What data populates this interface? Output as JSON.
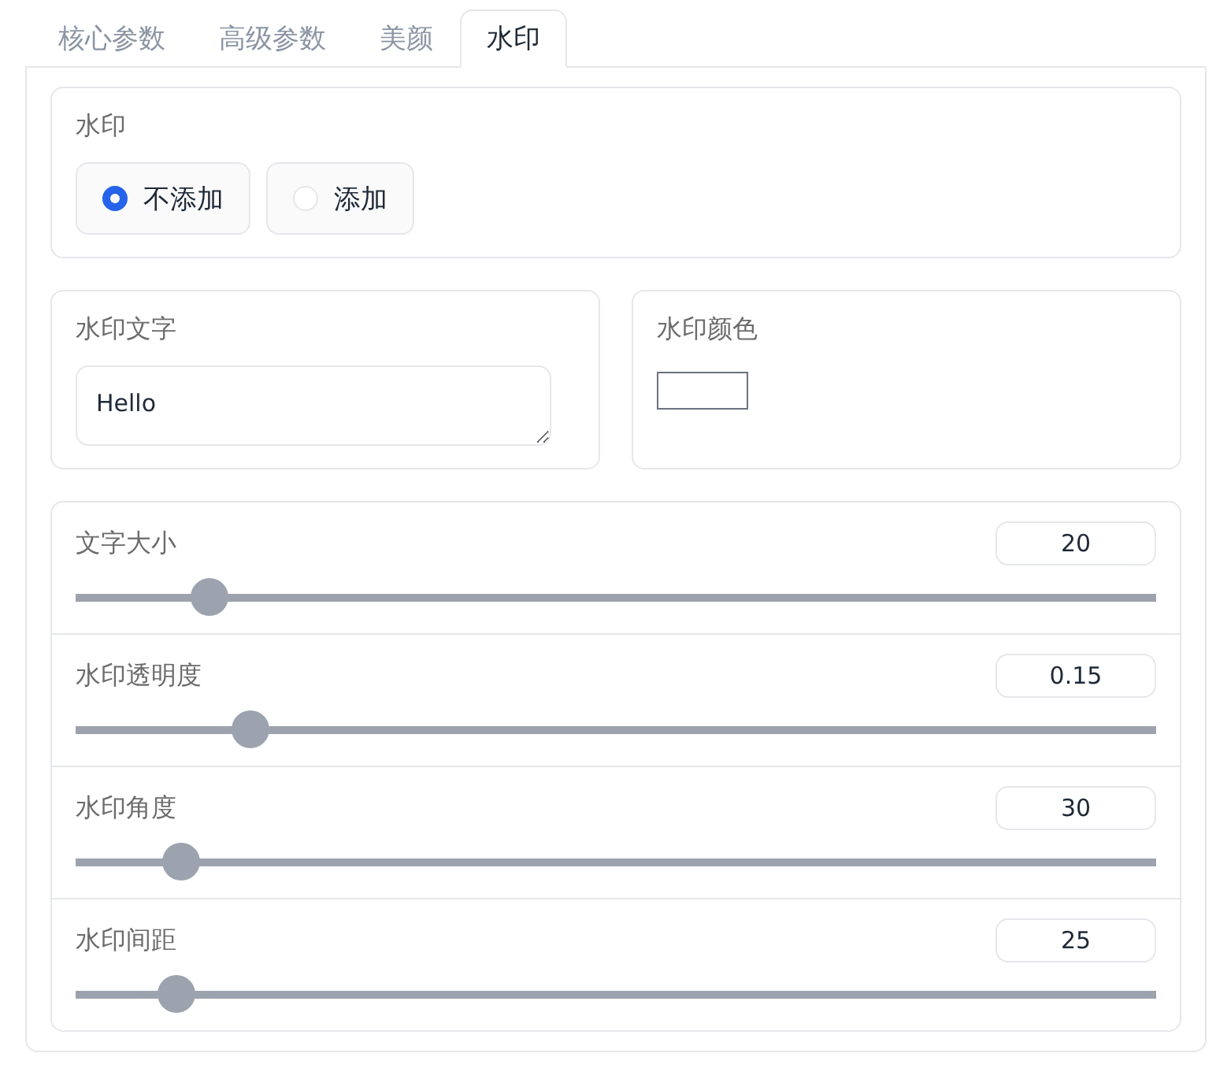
{
  "tabs": [
    {
      "label": "核心参数",
      "selected": false
    },
    {
      "label": "高级参数",
      "selected": false
    },
    {
      "label": "美颜",
      "selected": false
    },
    {
      "label": "水印",
      "selected": true
    }
  ],
  "watermark": {
    "label": "水印",
    "options": [
      {
        "label": "不添加",
        "selected": true
      },
      {
        "label": "添加",
        "selected": false
      }
    ]
  },
  "text_field": {
    "label": "水印文字",
    "value": "Hello"
  },
  "color_field": {
    "label": "水印颜色",
    "color": "#ffffff"
  },
  "sliders": [
    {
      "label": "文字大小",
      "value": "20",
      "level": 0.124
    },
    {
      "label": "水印透明度",
      "value": "0.15",
      "level": 0.162
    },
    {
      "label": "水印角度",
      "value": "30",
      "level": 0.098
    },
    {
      "label": "水印间距",
      "value": "25",
      "level": 0.093
    }
  ]
}
